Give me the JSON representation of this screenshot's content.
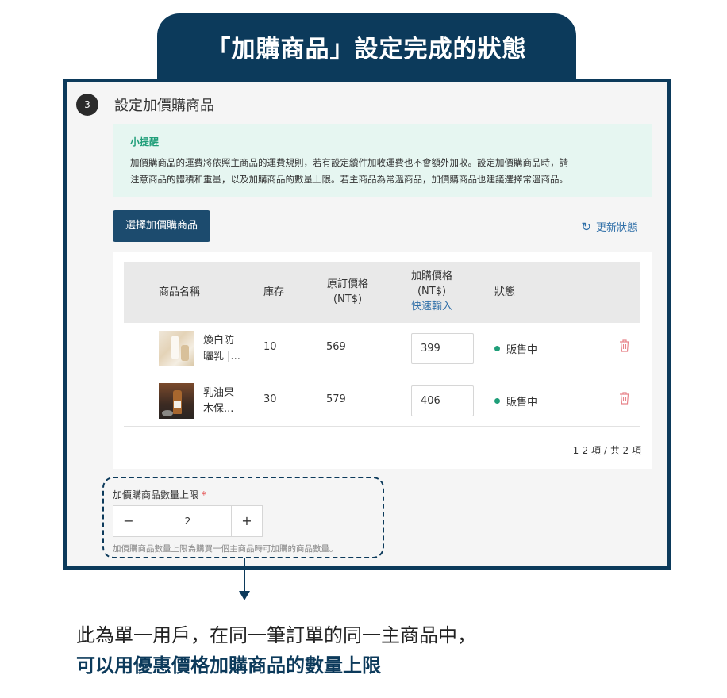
{
  "header": {
    "title": "「加購商品」設定完成的狀態"
  },
  "step": {
    "number": "3",
    "title": "設定加價購商品"
  },
  "tip": {
    "title": "小提醒",
    "line1": "加價購商品的運費將依照主商品的運費規則，若有設定續件加收運費也不會額外加收。設定加價購商品時，請",
    "line2": "注意商品的體積和重量，以及加購商品的數量上限。若主商品為常溫商品，加價購商品也建議選擇常溫商品。"
  },
  "actions": {
    "select_label": "選擇加價購商品",
    "refresh_label": "更新狀態",
    "refresh_icon": "refresh-icon"
  },
  "table": {
    "headers": {
      "name": "商品名稱",
      "stock": "庫存",
      "original_line1": "原訂價格",
      "original_line2": "(NT$)",
      "addon_line1": "加購價格",
      "addon_line2": "(NT$)",
      "quick_input": "快速輸入",
      "status": "狀態"
    },
    "rows": [
      {
        "name_line1": "煥白防",
        "name_line2": "曬乳 |...",
        "stock": "10",
        "original": "569",
        "addon": "399",
        "status": "販售中"
      },
      {
        "name_line1": "乳油果",
        "name_line2": "木保...",
        "stock": "30",
        "original": "579",
        "addon": "406",
        "status": "販售中"
      }
    ],
    "pagination": "1-2 項 / 共 2 項"
  },
  "limit": {
    "label": "加價購商品數量上限",
    "required_mark": "*",
    "minus": "−",
    "value": "2",
    "plus": "+",
    "hint": "加價購商品數量上限為購買一個主商品時可加購的商品數量。"
  },
  "caption": {
    "line1": "此為單一用戶，在同一筆訂單的同一主商品中，",
    "line2": "可以用優惠價格加購商品的數量上限"
  },
  "colors": {
    "navy": "#0c3a5b",
    "button": "#1c4b6e",
    "green": "#1f9e79",
    "link": "#2f6fa8",
    "danger": "#e23b3b"
  }
}
